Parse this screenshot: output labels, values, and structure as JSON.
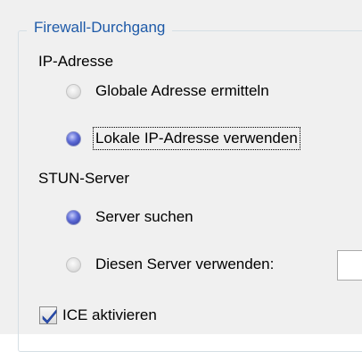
{
  "group": {
    "title": "Firewall-Durchgang"
  },
  "ip_section": {
    "label": "IP-Adresse",
    "options": [
      {
        "label": "Globale Adresse ermitteln",
        "selected": false
      },
      {
        "label": "Lokale IP-Adresse verwenden",
        "selected": true
      }
    ]
  },
  "stun_section": {
    "label": "STUN-Server",
    "options": [
      {
        "label": "Server suchen",
        "selected": true
      },
      {
        "label": "Diesen Server verwenden:",
        "selected": false
      }
    ],
    "server_value": ""
  },
  "ice": {
    "label": "ICE aktivieren",
    "checked": true
  },
  "colors": {
    "legend_text": "#1e5aa8",
    "radio_selected": "#3d48b8",
    "check_mark": "#2b4fb3"
  }
}
